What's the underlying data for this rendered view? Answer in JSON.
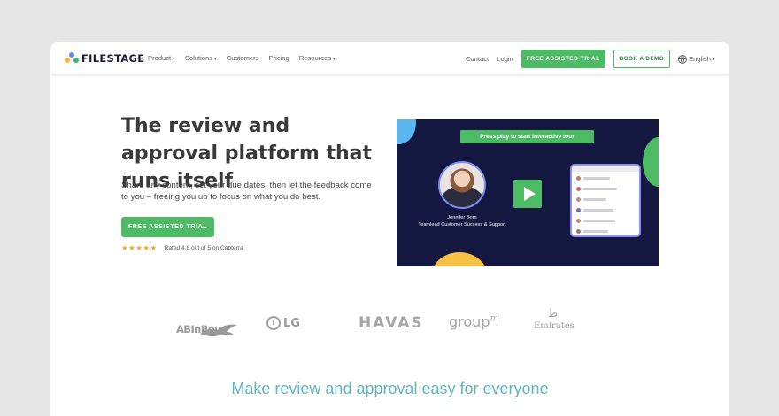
{
  "nav": {
    "brand": "FILESTAGE",
    "links": [
      {
        "label": "Product",
        "dropdown": true
      },
      {
        "label": "Solutions",
        "dropdown": true
      },
      {
        "label": "Customers",
        "dropdown": false
      },
      {
        "label": "Pricing",
        "dropdown": false
      },
      {
        "label": "Resources",
        "dropdown": true
      }
    ],
    "contact": "Contact",
    "login": "Login",
    "trial_button": "FREE ASSISTED TRIAL",
    "demo_button": "BOOK A DEMO",
    "language": "English"
  },
  "hero": {
    "title": "The review and approval platform that runs itself",
    "subtitle": "Share any content, set your due dates, then let the feedback come to you – freeing you up to focus on what you do best.",
    "cta": "FREE ASSISTED TRIAL",
    "stars": "★★★★★",
    "rating": "Rated 4.8 out of 5 on Capterra"
  },
  "video": {
    "banner": "Press play to start interactive tour",
    "presenter_name": "Jennifer Born",
    "presenter_role": "Teamlead Customer Success & Support"
  },
  "logos": {
    "abinbev": "ABInBev",
    "lg": "LG",
    "havas": "HAVAS",
    "groupm": "group",
    "groupm_sup": "m",
    "emirates_glyph": "ﻃ",
    "emirates": "Emirates"
  },
  "section": {
    "title": "Make review and approval easy for everyone"
  },
  "colors": {
    "brand_green": "#4cbb63",
    "video_bg": "#14173f",
    "section_title": "#5fb4bd"
  }
}
